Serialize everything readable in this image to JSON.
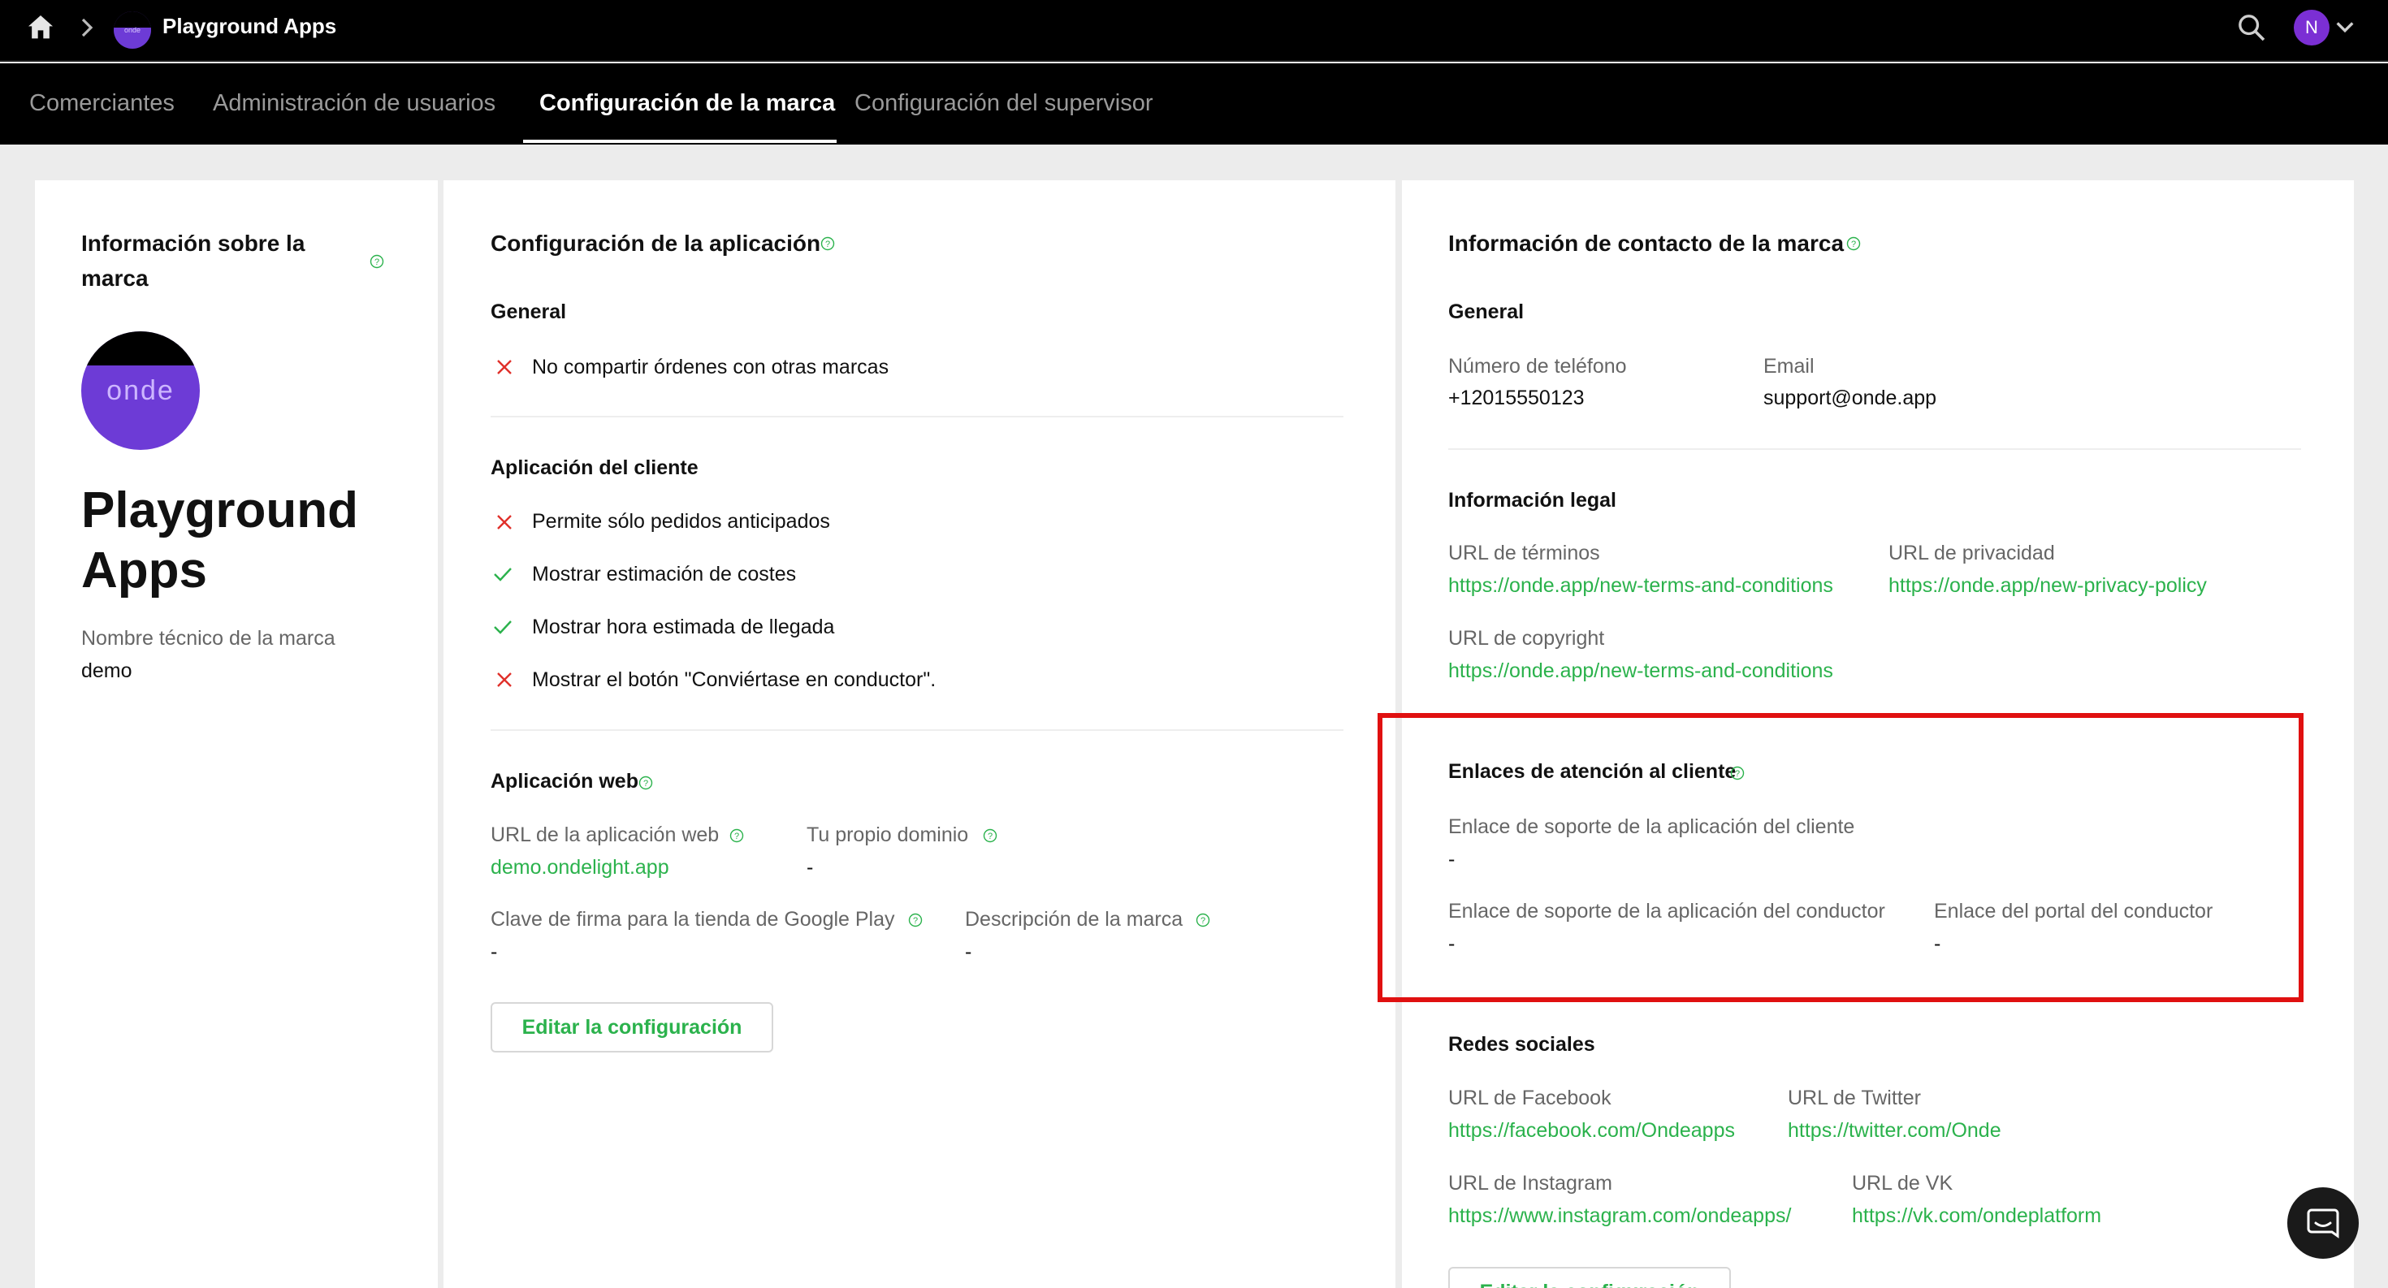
{
  "topbar": {
    "app_title": "Playground Apps",
    "logo_text": "onde",
    "user_initial": "N"
  },
  "tabs": [
    {
      "label": "Comerciantes",
      "active": false
    },
    {
      "label": "Administración de usuarios",
      "active": false
    },
    {
      "label": "Configuración de la marca",
      "active": true
    },
    {
      "label": "Configuración del supervisor",
      "active": false
    }
  ],
  "brand_info": {
    "title": "Información sobre la marca",
    "logo_text": "onde",
    "name_line1": "Playground",
    "name_line2": "Apps",
    "tech_name_label": "Nombre técnico de la marca",
    "tech_name_value": "demo"
  },
  "app_config": {
    "title": "Configuración de la aplicación",
    "general": {
      "heading": "General",
      "items": [
        {
          "label": "No compartir órdenes con otras marcas",
          "enabled": false
        }
      ]
    },
    "client_app": {
      "heading": "Aplicación del cliente",
      "items": [
        {
          "label": "Permite sólo pedidos anticipados",
          "enabled": false
        },
        {
          "label": "Mostrar estimación de costes",
          "enabled": true
        },
        {
          "label": "Mostrar hora estimada de llegada",
          "enabled": true
        },
        {
          "label": "Mostrar el botón \"Conviértase en conductor\".",
          "enabled": false
        }
      ]
    },
    "web_app": {
      "heading": "Aplicación web",
      "url_label": "URL de la aplicación web",
      "url_value": "demo.ondelight.app",
      "domain_label": "Tu propio dominio",
      "domain_value": "-",
      "signing_key_label": "Clave de firma para la tienda de Google Play",
      "signing_key_value": "-",
      "description_label": "Descripción de la marca",
      "description_value": "-"
    },
    "edit_button": "Editar la configuración"
  },
  "contact_info": {
    "title": "Información de contacto de la marca",
    "general": {
      "heading": "General",
      "phone_label": "Número de teléfono",
      "phone_value": "+12015550123",
      "email_label": "Email",
      "email_value": "support@onde.app"
    },
    "legal": {
      "heading": "Información legal",
      "terms_label": "URL de términos",
      "terms_value": "https://onde.app/new-terms-and-conditions",
      "privacy_label": "URL de privacidad",
      "privacy_value": "https://onde.app/new-privacy-policy",
      "copyright_label": "URL de copyright",
      "copyright_value": "https://onde.app/new-terms-and-conditions"
    },
    "support_links": {
      "heading": "Enlaces de atención al cliente",
      "client_support_label": "Enlace de soporte de la aplicación del cliente",
      "client_support_value": "-",
      "driver_support_label": "Enlace de soporte de la aplicación del conductor",
      "driver_support_value": "-",
      "driver_portal_label": "Enlace del portal del conductor",
      "driver_portal_value": "-"
    },
    "social": {
      "heading": "Redes sociales",
      "facebook_label": "URL de Facebook",
      "facebook_value": "https://facebook.com/Ondeapps",
      "twitter_label": "URL de Twitter",
      "twitter_value": "https://twitter.com/Onde",
      "instagram_label": "URL de Instagram",
      "instagram_value": "https://www.instagram.com/ondeapps/",
      "vk_label": "URL de VK",
      "vk_value": "https://vk.com/ondeplatform"
    },
    "edit_button": "Editar la configuración"
  },
  "colors": {
    "accent": "#2bb24c",
    "highlight": "#e01010",
    "brand_purple": "#6d3bd6",
    "disabled_mark": "#e0302a"
  }
}
